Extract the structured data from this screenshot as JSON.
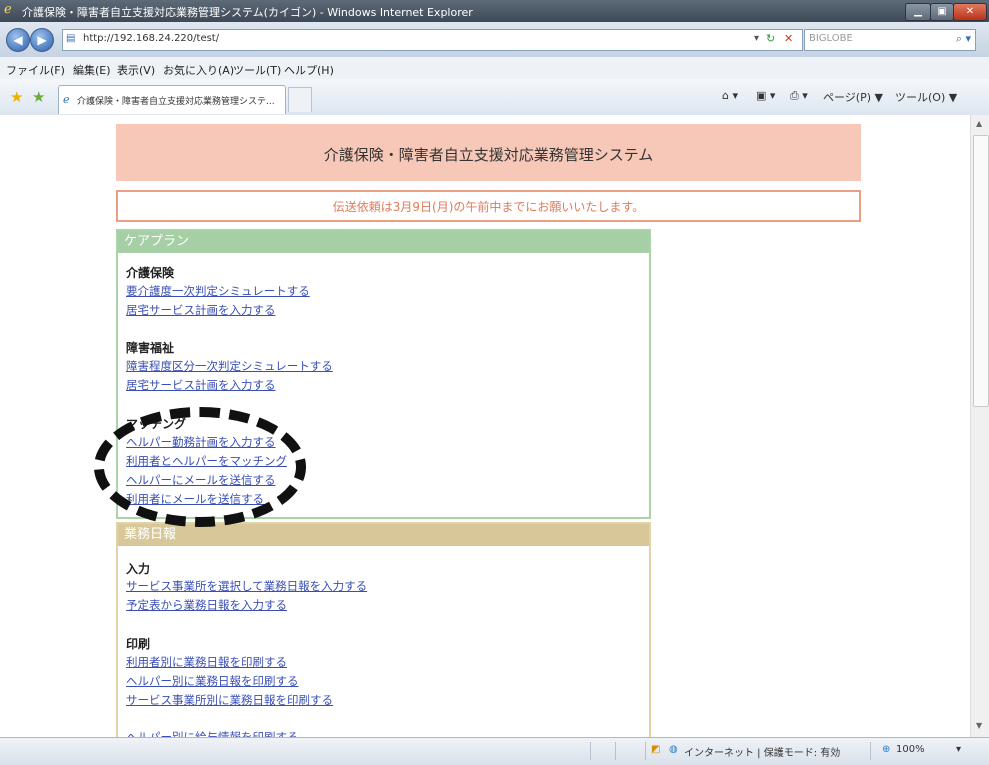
{
  "window": {
    "title": "介護保険・障害者自立支援対応業務管理システム(カイゴン) - Windows Internet Explorer"
  },
  "address_bar": {
    "url": "http://192.168.24.220/test/",
    "search_placeholder": "BIGLOBE"
  },
  "menu": [
    "ファイル(F)",
    "編集(E)",
    "表示(V)",
    "お気に入り(A)",
    "ツール(T)",
    "ヘルプ(H)"
  ],
  "tab": {
    "label": "介護保険・障害者自立支援対応業務管理システ..."
  },
  "command_bar": {
    "page_label": "ページ(P) ▼",
    "tools_label": "ツール(O) ▼"
  },
  "page": {
    "header_title": "介護保険・障害者自立支援対応業務管理システム",
    "notice": "伝送依頼は3月9日(月)の午前中までにお願いいたします。",
    "careplan": {
      "heading": "ケアプラン",
      "kaigo_title": "介護保険",
      "kaigo_links": [
        "要介護度一次判定シミュレートする",
        "居宅サービス計画を入力する"
      ],
      "shogai_title": "障害福祉",
      "shogai_links": [
        "障害程度区分一次判定シミュレートする",
        "居宅サービス計画を入力する"
      ],
      "matching_title": "マッチング",
      "matching_links": [
        "ヘルパー勤務計画を入力する",
        "利用者とヘルパーをマッチング",
        "ヘルパーにメールを送信する",
        "利用者にメールを送信する"
      ]
    },
    "gyomu": {
      "heading": "業務日報",
      "input_title": "入力",
      "input_links": [
        "サービス事業所を選択して業務日報を入力する",
        "予定表から業務日報を入力する"
      ],
      "print_title": "印刷",
      "print_links": [
        "利用者別に業務日報を印刷する",
        "ヘルパー別に業務日報を印刷する",
        "サービス事業所別に業務日報を印刷する",
        "ヘルパー別に給与情報を印刷する"
      ]
    }
  },
  "status_bar": {
    "zone": "インターネット | 保護モード: 有効",
    "zoom": "100%"
  },
  "colors": {
    "header_bg": "#f7c8b8",
    "notice_border": "#e99f84",
    "careplan_header": "#a6cfa6",
    "gyomu_header": "#d8c899",
    "link": "#3a4fb5"
  }
}
